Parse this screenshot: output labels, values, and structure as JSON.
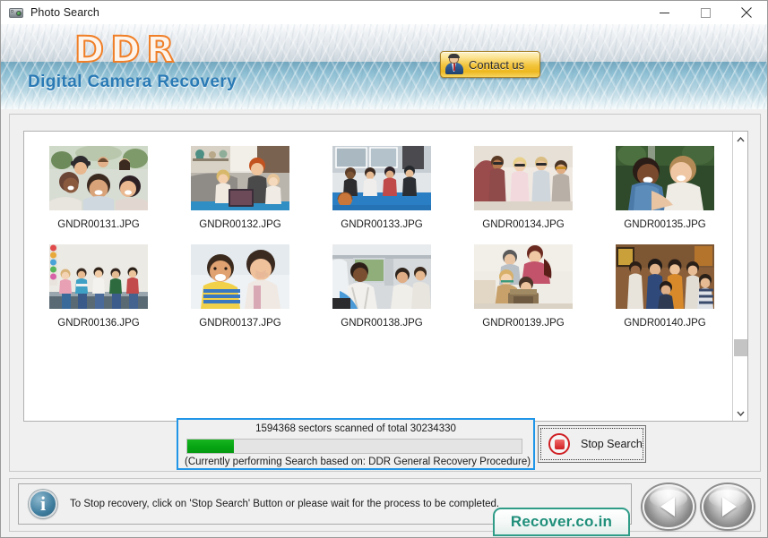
{
  "window": {
    "title": "Photo Search",
    "icon": "camera-icon",
    "controls": {
      "minimize": "minimize",
      "maximize": "maximize",
      "close": "close"
    }
  },
  "banner": {
    "logo": "DDR",
    "tagline": "Digital Camera Recovery",
    "contact_button": "Contact us",
    "contact_icon": "person-icon"
  },
  "thumbnails": [
    {
      "filename": "GNDR00131.JPG",
      "scene": "group-selfie-friends-outdoors"
    },
    {
      "filename": "GNDR00132.JPG",
      "scene": "mother-with-children-tablet-sofa"
    },
    {
      "filename": "GNDR00133.JPG",
      "scene": "friends-sitting-gym-floor-basketball"
    },
    {
      "filename": "GNDR00134.JPG",
      "scene": "four-friends-sunglasses-outdoors"
    },
    {
      "filename": "GNDR00135.JPG",
      "scene": "two-women-hugging-laughing"
    },
    {
      "filename": "GNDR00136.JPG",
      "scene": "children-standing-in-classroom"
    },
    {
      "filename": "GNDR00137.JPG",
      "scene": "boy-and-girl-laughing"
    },
    {
      "filename": "GNDR00138.JPG",
      "scene": "family-inside-car"
    },
    {
      "filename": "GNDR00139.JPG",
      "scene": "family-with-typewriter-indoors"
    },
    {
      "filename": "GNDR00140.JPG",
      "scene": "group-of-people-talking-indoors"
    }
  ],
  "scrollbar": {
    "up_arrow": "chevron-up-icon",
    "down_arrow": "chevron-down-icon"
  },
  "progress": {
    "status_text": "1594368  sectors scanned of total 30234330",
    "sectors_scanned": 1594368,
    "sectors_total": 30234330,
    "bar_percent": 14,
    "detail_text": "(Currently performing Search based on:  DDR General Recovery Procedure)",
    "fill_color": "#06a413",
    "border_color": "#2196e8"
  },
  "stop_button": {
    "label": "Stop Search",
    "icon": "stop-circle-icon"
  },
  "info_bar": {
    "icon": "info-icon",
    "message": "To Stop recovery, click on 'Stop Search' Button or please wait for the process to be completed."
  },
  "brand_tag": {
    "label": "Recover.co.in",
    "color": "#1f8f7a"
  },
  "nav": {
    "back": "previous-icon",
    "next": "next-icon"
  }
}
